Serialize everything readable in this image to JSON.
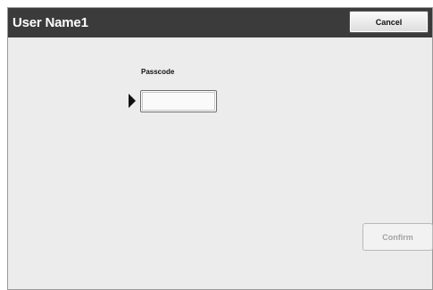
{
  "header": {
    "title": "User Name1",
    "cancel_label": "Cancel"
  },
  "form": {
    "passcode_label": "Passcode",
    "passcode_value": "",
    "confirm_label": "Confirm",
    "confirm_enabled": false
  },
  "icons": {
    "field_pointer": "pointer-triangle-icon"
  },
  "colors": {
    "title_bar": "#3b3b3b",
    "panel_background": "#ececec",
    "disabled_text": "#a4a4a4"
  }
}
